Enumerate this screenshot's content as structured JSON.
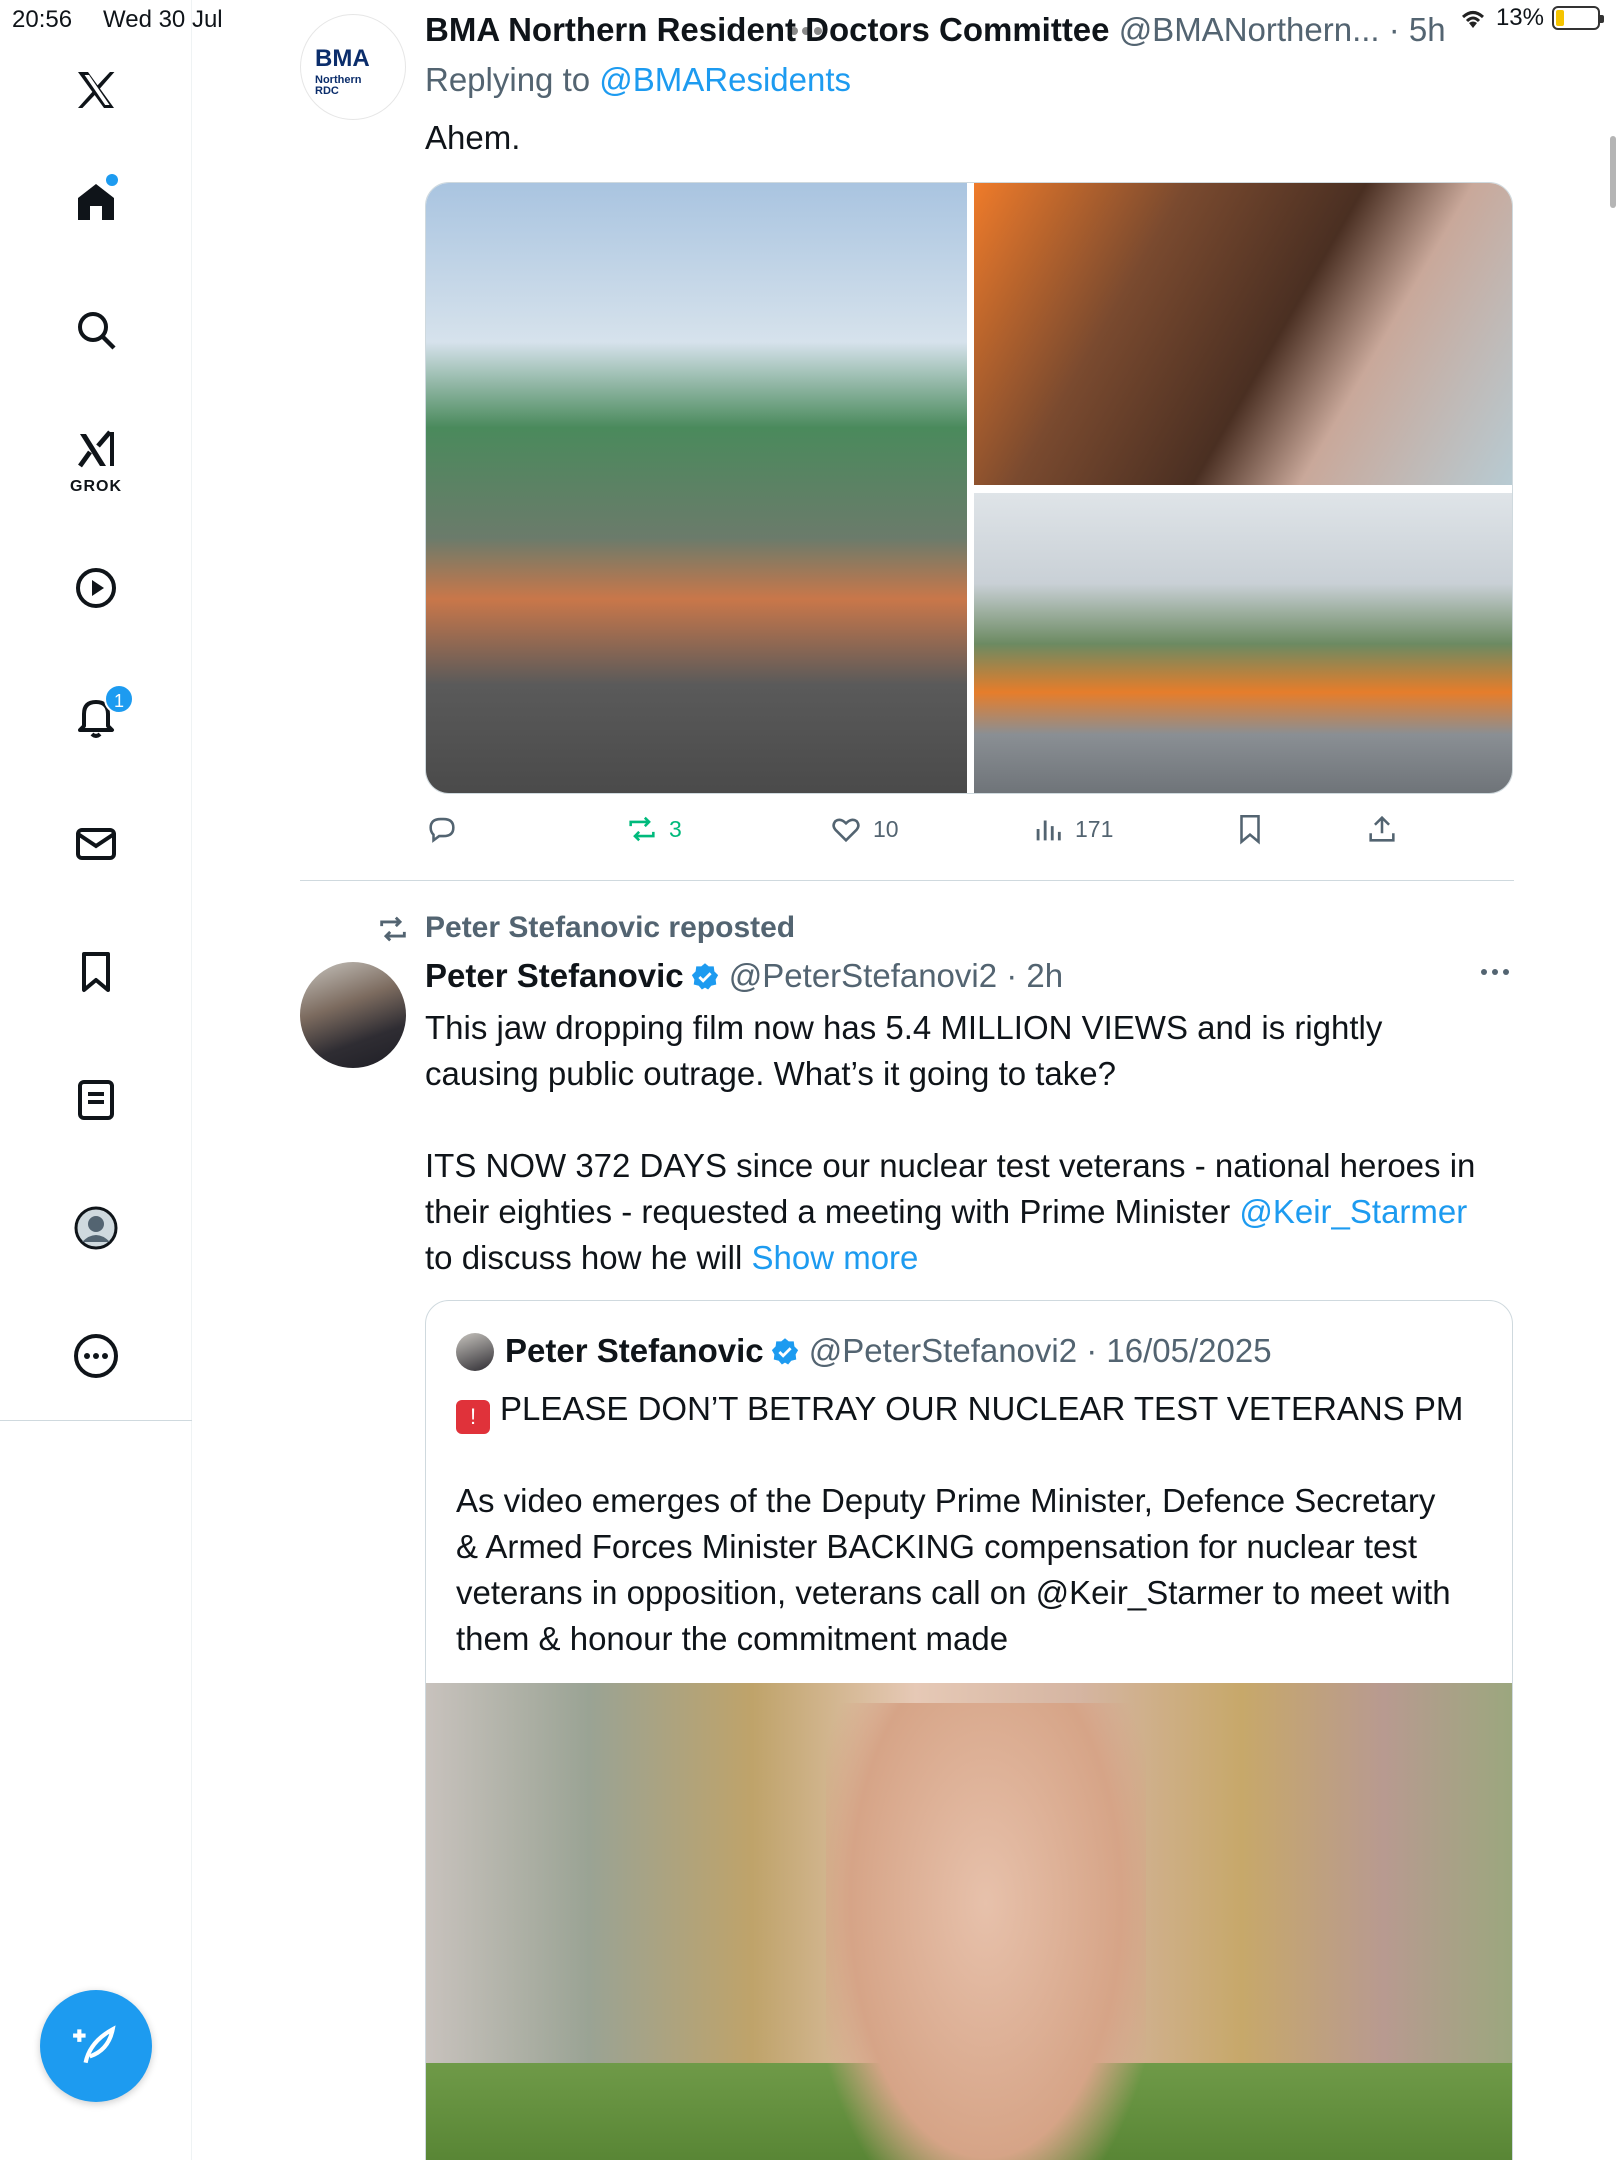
{
  "status_bar": {
    "time": "20:56",
    "date": "Wed 30 Jul",
    "battery": "13%"
  },
  "sidebar": {
    "items": [
      {
        "name": "x-logo-icon"
      },
      {
        "name": "home-icon",
        "has_dot": true
      },
      {
        "name": "search-icon"
      },
      {
        "name": "grok-icon",
        "label": "GROK"
      },
      {
        "name": "video-icon"
      },
      {
        "name": "notifications-icon",
        "badge": "1"
      },
      {
        "name": "messages-icon"
      },
      {
        "name": "bookmarks-icon"
      },
      {
        "name": "lists-icon"
      },
      {
        "name": "profile-icon"
      },
      {
        "name": "more-icon"
      }
    ],
    "accent": "#1d9bf0"
  },
  "tweet1": {
    "author_name": "BMA Northern Resident Doctors Committee",
    "handle_time": "@BMANorthern... · 5h",
    "avatar_text": "BMA",
    "avatar_sub": "Northern",
    "avatar_sub2": "RDC",
    "replying_prefix": "Replying to",
    "replying_to": "@BMAResidents",
    "text": "Ahem.",
    "actions": {
      "replies": "",
      "reposts": "3",
      "likes": "10",
      "views": "171"
    },
    "repost_color": "#00ba7c"
  },
  "tweet2": {
    "repost_label": "Peter Stefanovic reposted",
    "author_name": "Peter Stefanovic",
    "handle_time": "@PeterStefanovi2 · 2h",
    "text_line1": "This jaw dropping film now has 5.4 MILLION VIEWS and is rightly",
    "text_line2": "causing public outrage. What’s it going to take?",
    "text_line3": "ITS NOW 372 DAYS since our nuclear test veterans - national heroes in",
    "text_line4a": "their eighties - requested a meeting with Prime Minister",
    "mention": "@Keir_Starmer",
    "text_line5a": "to discuss how he will",
    "show_more": "Show more"
  },
  "quote": {
    "author_name": "Peter Stefanovic",
    "handle_date": "@PeterStefanovi2 · 16/05/2025",
    "line1": "PLEASE DON’T BETRAY OUR NUCLEAR TEST VETERANS PM",
    "line2": "As video emerges of the Deputy Prime Minister, Defence Secretary",
    "line3": "& Armed Forces Minister BACKING compensation for nuclear test",
    "line4": "veterans in opposition, veterans call on @Keir_Starmer to meet with",
    "line5": "them & honour the commitment made"
  }
}
